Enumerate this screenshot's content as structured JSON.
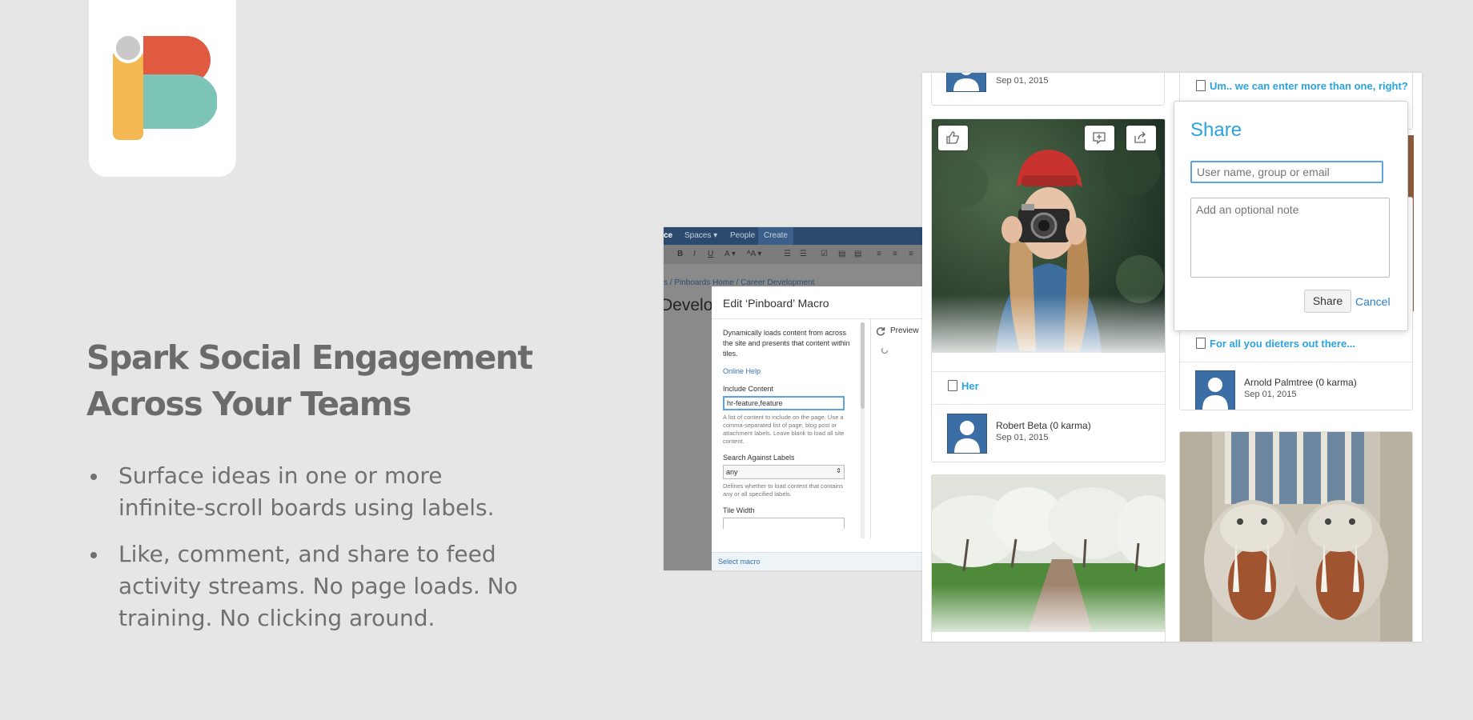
{
  "headline": {
    "line1": "Spark Social Engagement",
    "line2": "Across Your Teams"
  },
  "bullets": [
    {
      "line1": "Surface ideas in one or more",
      "line2": "infinite-scroll boards using labels."
    },
    {
      "line1": "Like, comment, and share to feed",
      "line2": "activity streams. No page loads. No",
      "line3": "training. No clicking around."
    }
  ],
  "editor": {
    "nav": {
      "brand": "ce",
      "spaces": "Spaces ▾",
      "people": "People",
      "create": "Create"
    },
    "breadcrumb": "s  /  Pinboards Home  /  Career Development",
    "page_heading": "Develop",
    "macro": {
      "title": "Edit ‘Pinboard’ Macro",
      "description": "Dynamically loads content from across the site and presents that content within tiles.",
      "online_help": "Online Help",
      "include_content_label": "Include Content",
      "include_content_value": "hr-feature,feature",
      "include_content_help": "A list of content to include on the page. Use a comma-separated list of page, blog post or attachment labels. Leave blank to load all site content.",
      "search_labels_label": "Search Against Labels",
      "search_labels_value": "any",
      "search_labels_help": "Defines whether to load content that contains any or all specified labels.",
      "tile_width_label": "Tile Width",
      "preview_label": "Preview",
      "select_macro": "Select macro"
    }
  },
  "board": {
    "top_tile_date": "Sep 01, 2015",
    "top_right_link": "Um.. we can enter more than one, right?",
    "photo_tile": {
      "link": "Her",
      "author": "Robert Beta (0 karma)",
      "date": "Sep 01, 2015"
    },
    "diet_tile": {
      "link": "For all you dieters out there...",
      "author": "Arnold Palmtree (0 karma)",
      "date": "Sep 01, 2015"
    }
  },
  "share": {
    "title": "Share",
    "input_placeholder": "User name, group or email",
    "note_placeholder": "Add an optional note",
    "share_button": "Share",
    "cancel_link": "Cancel"
  },
  "colors": {
    "accent": "#2ba3e0",
    "logo_red": "#e05a42",
    "logo_teal": "#7cc4b5",
    "logo_yellow": "#f3b851",
    "logo_grey": "#c9c9c9"
  }
}
